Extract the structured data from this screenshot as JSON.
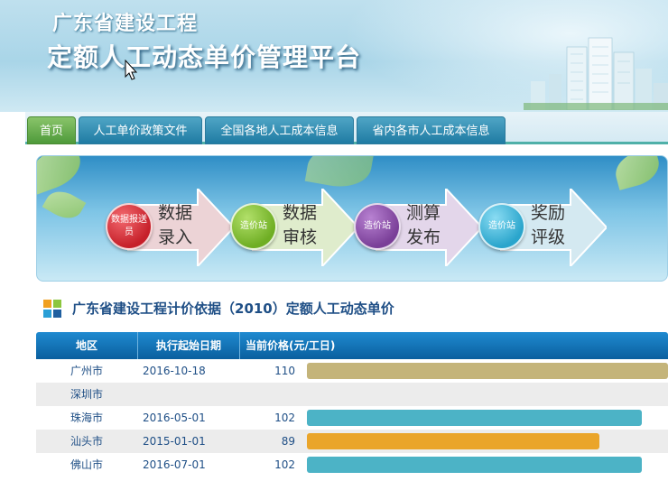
{
  "header": {
    "title_line1": "广东省建设工程",
    "title_line2": "定额人工动态单价管理平台"
  },
  "nav": {
    "tabs": [
      {
        "label": "首页",
        "active": true
      },
      {
        "label": "人工单价政策文件",
        "active": false
      },
      {
        "label": "全国各地人工成本信息",
        "active": false
      },
      {
        "label": "省内各市人工成本信息",
        "active": false
      }
    ]
  },
  "process": {
    "steps": [
      {
        "badge": "数据报送员",
        "label": "数据录入",
        "color": "#c6202a"
      },
      {
        "badge": "造价站",
        "label": "数据审核",
        "color": "#6fae24"
      },
      {
        "badge": "造价站",
        "label": "测算发布",
        "color": "#7a3f98"
      },
      {
        "badge": "造价站",
        "label": "奖励评级",
        "color": "#2aa5cc"
      }
    ]
  },
  "section": {
    "title": "广东省建设工程计价依据（2010）定额人工动态单价"
  },
  "table": {
    "headers": [
      "地区",
      "执行起始日期",
      "当前价格(元/工日)"
    ],
    "rows": [
      {
        "region": "广州市",
        "date": "2016-10-18",
        "price": "110",
        "value": 110,
        "color": "#c4b47a"
      },
      {
        "region": "深圳市",
        "date": "",
        "price": "",
        "value": null,
        "color": ""
      },
      {
        "region": "珠海市",
        "date": "2016-05-01",
        "price": "102",
        "value": 102,
        "color": "#4cb3c6"
      },
      {
        "region": "汕头市",
        "date": "2015-01-01",
        "price": "89",
        "value": 89,
        "color": "#eaa52a"
      },
      {
        "region": "佛山市",
        "date": "2016-07-01",
        "price": "102",
        "value": 102,
        "color": "#4cb3c6"
      }
    ]
  }
}
